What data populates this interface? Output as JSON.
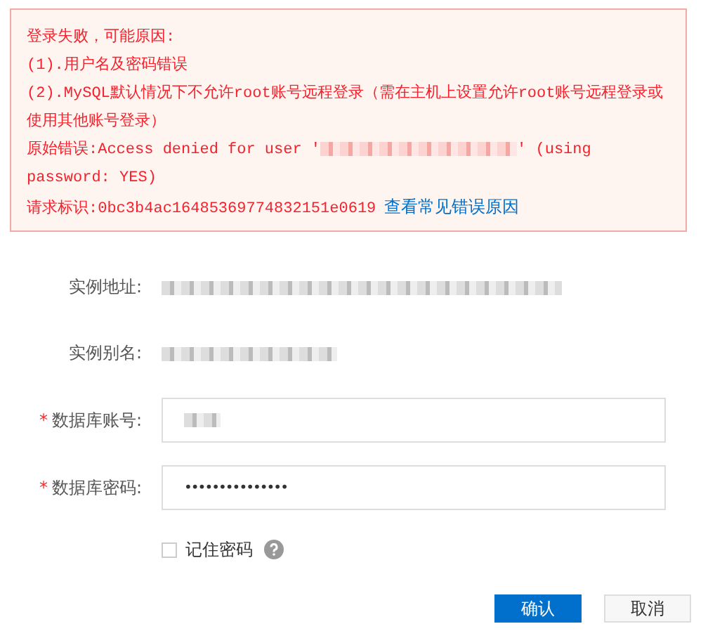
{
  "alert": {
    "title": "登录失败，可能原因:",
    "reasons": [
      "(1).用户名及密码错误",
      "(2).MySQL默认情况下不允许root账号远程登录（需在主机上设置允许root账号远程登录或使用其他账号登录）"
    ],
    "raw_error": {
      "label": "原始错误:",
      "before": "Access denied for user '",
      "user_redacted": true,
      "after_lines": [
        "' (using",
        "password: YES)"
      ]
    },
    "request_id": {
      "label": "请求标识:",
      "value": "0bc3b4ac16485369774832151e0619",
      "link": "查看常见错误原因"
    }
  },
  "form": {
    "required_mark": "*",
    "rows": [
      {
        "kind": "static",
        "label": "实例地址:",
        "required": false,
        "value_redacted": true
      },
      {
        "kind": "static",
        "label": "实例别名:",
        "required": false,
        "value_redacted": true
      },
      {
        "kind": "text",
        "label": "数据库账号:",
        "required": true,
        "value_redacted": true
      },
      {
        "kind": "password",
        "label": "数据库密码:",
        "required": true,
        "value": "•••••••••••••••"
      }
    ],
    "remember": {
      "label": "记住密码",
      "checked": false
    },
    "buttons": [
      {
        "label": "确认",
        "kind": "primary"
      },
      {
        "label": "取消",
        "kind": "default"
      }
    ]
  }
}
